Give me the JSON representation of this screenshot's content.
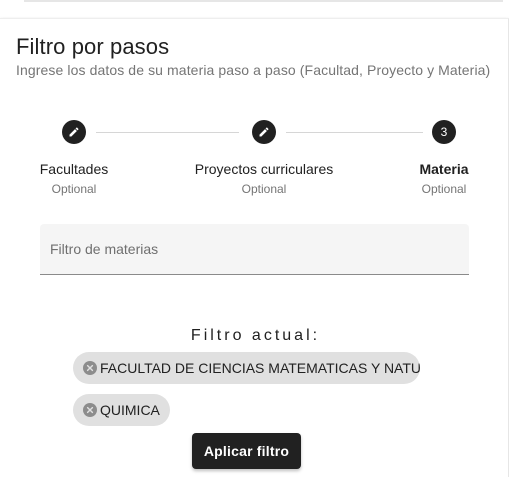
{
  "card": {
    "title": "Filtro por pasos",
    "subtitle": "Ingrese los datos de su materia paso a paso (Facultad, Proyecto y Materia)"
  },
  "steps": [
    {
      "label": "Facultades",
      "optional": "Optional",
      "icon": "edit-icon",
      "state": "edit"
    },
    {
      "label": "Proyectos curriculares",
      "optional": "Optional",
      "icon": "edit-icon",
      "state": "edit"
    },
    {
      "label": "Materia",
      "optional": "Optional",
      "number": "3",
      "state": "active"
    }
  ],
  "filter": {
    "placeholder": "Filtro de materias",
    "value": ""
  },
  "current_filter": {
    "label": "Filtro actual:",
    "chips": [
      {
        "text": "FACULTAD DE CIENCIAS MATEMATICAS Y NATURA",
        "icon": "remove-icon"
      },
      {
        "text": "QUIMICA",
        "icon": "remove-icon"
      }
    ]
  },
  "actions": {
    "apply_label": "Aplicar filtro"
  },
  "colors": {
    "primary": "#212121",
    "chip_bg": "#e0e0e0",
    "field_bg": "#f5f5f5",
    "muted_text": "#757575"
  }
}
